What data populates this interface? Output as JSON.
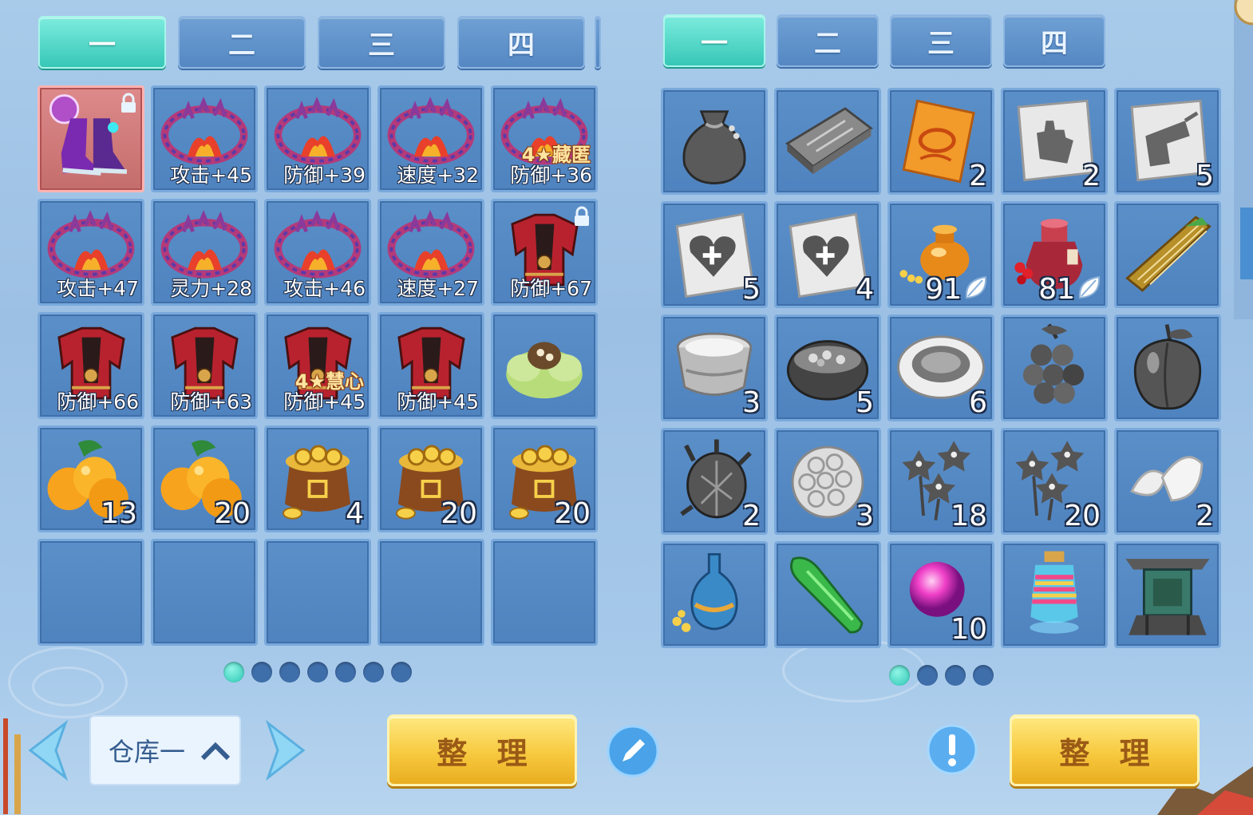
{
  "left_tabs": [
    "一",
    "二",
    "三",
    "四"
  ],
  "right_tabs": [
    "一",
    "二",
    "三",
    "四"
  ],
  "warehouse": {
    "slots": [
      {
        "icon": "boots-icon",
        "selected": true,
        "locked": true
      },
      {
        "icon": "flame-ring-icon",
        "stat": "攻击+45"
      },
      {
        "icon": "flame-ring-icon",
        "stat": "防御+39"
      },
      {
        "icon": "flame-ring-icon",
        "stat": "速度+32"
      },
      {
        "icon": "flame-ring-icon",
        "badge": "4★藏匿",
        "stat": "防御+36"
      },
      {
        "icon": "flame-ring-icon",
        "stat": "攻击+47"
      },
      {
        "icon": "flame-ring-icon",
        "stat": "灵力+28"
      },
      {
        "icon": "flame-ring-icon",
        "stat": "攻击+46"
      },
      {
        "icon": "flame-ring-icon",
        "stat": "速度+27"
      },
      {
        "icon": "armor-icon",
        "stat": "防御+67",
        "locked": true
      },
      {
        "icon": "armor-icon",
        "stat": "防御+66"
      },
      {
        "icon": "armor-icon",
        "stat": "防御+63"
      },
      {
        "icon": "armor-icon",
        "badge": "4★慧心",
        "stat": "防御+45"
      },
      {
        "icon": "armor-icon",
        "stat": "防御+45"
      },
      {
        "icon": "cabbage-icon"
      },
      {
        "icon": "orange-icon",
        "count": "13"
      },
      {
        "icon": "orange-icon",
        "count": "20"
      },
      {
        "icon": "coin-bag-icon",
        "count": "4"
      },
      {
        "icon": "coin-bag-icon",
        "count": "20"
      },
      {
        "icon": "coin-bag-icon",
        "count": "20"
      },
      {
        "icon": "empty"
      },
      {
        "icon": "empty"
      },
      {
        "icon": "empty"
      },
      {
        "icon": "empty"
      },
      {
        "icon": "empty"
      }
    ],
    "page_dots": 7,
    "active_dot": 0,
    "name": "仓库一",
    "sort_label": "整 理"
  },
  "bag": {
    "slots": [
      {
        "icon": "pouch-icon"
      },
      {
        "icon": "mold-icon"
      },
      {
        "icon": "scroll-icon",
        "count": "2"
      },
      {
        "icon": "paper-hand-icon",
        "count": "2"
      },
      {
        "icon": "paper-hat-icon",
        "count": "5"
      },
      {
        "icon": "heal-card-icon",
        "count": "5"
      },
      {
        "icon": "heal-card-icon",
        "count": "4"
      },
      {
        "icon": "gold-jar-icon",
        "count": "91",
        "leaf": true
      },
      {
        "icon": "wine-jar-icon",
        "count": "81",
        "leaf": true
      },
      {
        "icon": "zither-icon"
      },
      {
        "icon": "bowl-icon",
        "count": "3"
      },
      {
        "icon": "cauldron-icon",
        "count": "5"
      },
      {
        "icon": "plate-icon",
        "count": "6"
      },
      {
        "icon": "grapes-icon"
      },
      {
        "icon": "peach-icon"
      },
      {
        "icon": "durian-icon",
        "count": "2"
      },
      {
        "icon": "scale-fruit-icon",
        "count": "3"
      },
      {
        "icon": "flowers-icon",
        "count": "18"
      },
      {
        "icon": "flowers-icon",
        "count": "20"
      },
      {
        "icon": "seeds-icon",
        "count": "2"
      },
      {
        "icon": "vase-icon"
      },
      {
        "icon": "jade-icon"
      },
      {
        "icon": "pink-orb-icon",
        "count": "10"
      },
      {
        "icon": "rainbow-lantern-icon"
      },
      {
        "icon": "bronze-altar-icon"
      }
    ],
    "page_dots": 4,
    "active_dot": 0,
    "sort_label": "整 理"
  },
  "colors": {
    "slot_bg": "#5588c3",
    "active_tab": "#37c7b7",
    "gold_button": "#f7c93f"
  }
}
